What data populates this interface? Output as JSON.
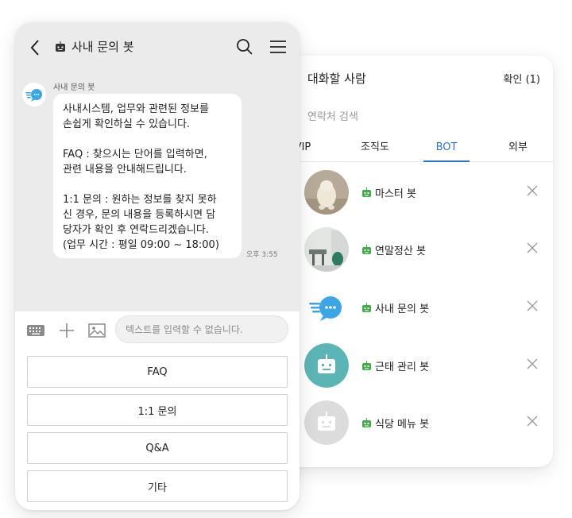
{
  "chat": {
    "header": {
      "title": "사내 문의 봇",
      "back_icon": "chevron-left-icon",
      "search_icon": "search-icon",
      "menu_icon": "hamburger-menu-icon"
    },
    "message": {
      "sender": "사내 문의 봇",
      "paragraphs": [
        "사내시스템, 업무와 관련된 정보를\n손쉽게 확인하실 수 있습니다.",
        "FAQ : 찾으시는 단어를 입력하면,\n관련 내용을 안내해드립니다.",
        "1:1 문의 : 원하는 정보를 찾지 못하\n신 경우, 문의 내용을 등록하시면 담\n당자가 확인 후 연락드리겠습니다.\n(업무 시간 : 평일 09:00 ~ 18:00)"
      ],
      "time": "오후 3:55"
    },
    "composer": {
      "placeholder": "텍스트를 입력할 수 없습니다.",
      "icons": [
        "keyboard-icon",
        "plus-icon",
        "image-icon"
      ]
    },
    "quick_replies": [
      "FAQ",
      "1:1 문의",
      "Q&A",
      "기타"
    ]
  },
  "picker": {
    "title": "대화할 사람",
    "confirm": "확인 (1)",
    "search_placeholder": "연락처 검색",
    "tabs": [
      {
        "label": "VIP",
        "active": false
      },
      {
        "label": "조직도",
        "active": false
      },
      {
        "label": "BOT",
        "active": true
      },
      {
        "label": "외부",
        "active": false
      }
    ],
    "bots": [
      {
        "name": "마스터 봇",
        "avatar": "plush-toy-photo"
      },
      {
        "name": "연말정산 봇",
        "avatar": "office-photo"
      },
      {
        "name": "사내 문의 봇",
        "avatar": "chat-bubble-logo"
      },
      {
        "name": "근태 관리 봇",
        "avatar": "robot-icon-teal"
      },
      {
        "name": "식당 메뉴 봇",
        "avatar": "robot-icon-gray"
      }
    ]
  },
  "colors": {
    "accent_blue": "#2f6fd6",
    "bot_badge_green": "#3fae49",
    "chat_background": "#ebebeb",
    "teal_avatar": "#5bb5b5",
    "gray_avatar": "#dcdcdc",
    "logo_blue": "#3aa6e8"
  }
}
